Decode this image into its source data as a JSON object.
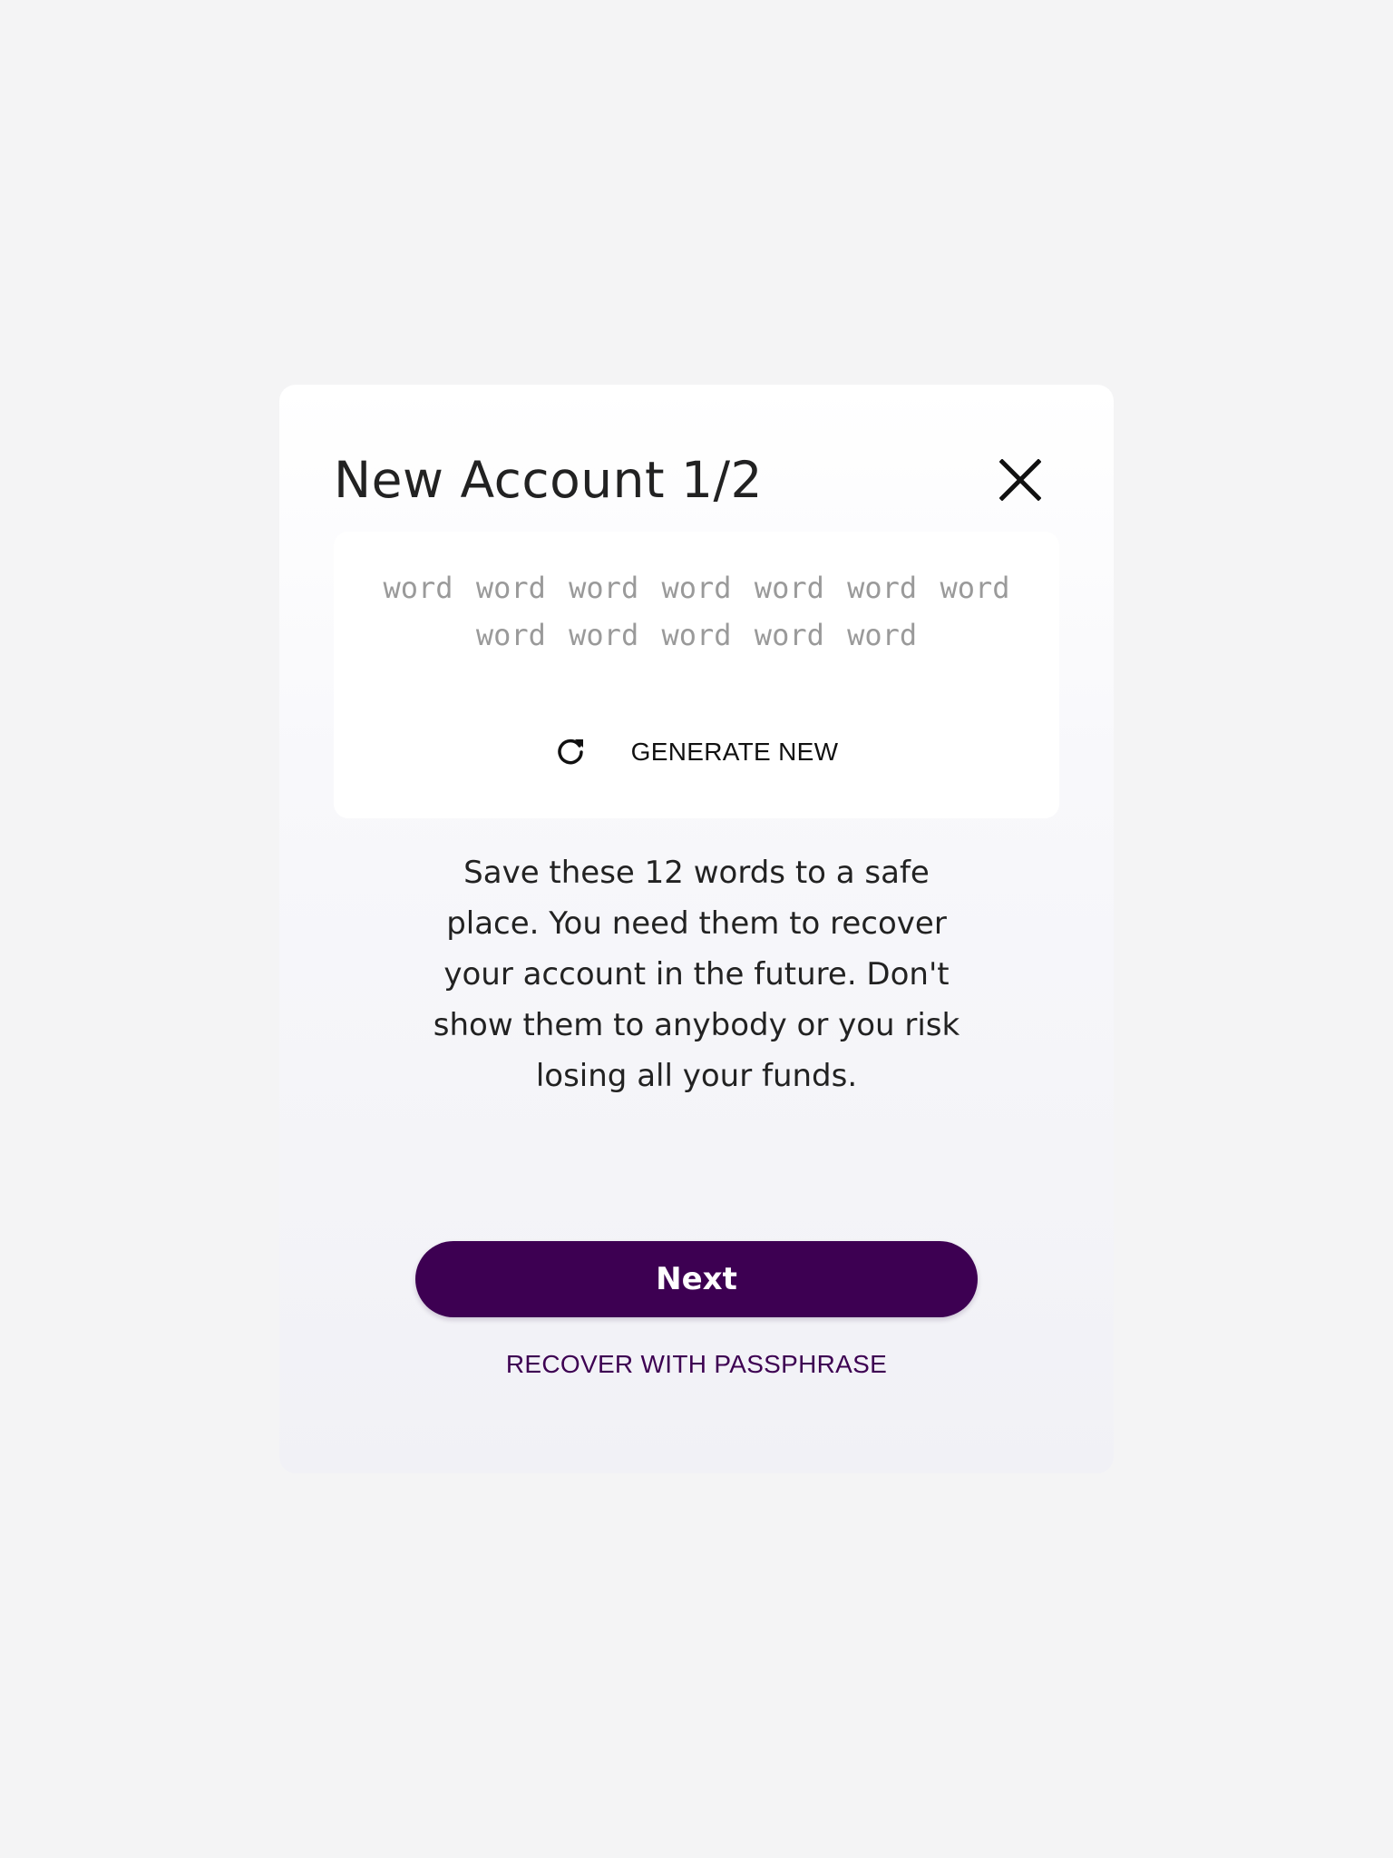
{
  "dialog": {
    "title": "New Account 1/2",
    "close_icon": "close-icon"
  },
  "passphrase": {
    "words": "word word word word word word word word word word word word",
    "generate_label": "GENERATE NEW",
    "generate_icon": "refresh-icon"
  },
  "info_text": "Save these 12 words to a safe place. You need them to recover your account in the future. Don't show them to anybody or you risk losing all your funds.",
  "actions": {
    "next_label": "Next",
    "recover_label": "RECOVER WITH PASSPHRASE"
  },
  "colors": {
    "accent": "#3d0052",
    "background": "#f4f4f5",
    "word_text": "#9a9a9a"
  }
}
